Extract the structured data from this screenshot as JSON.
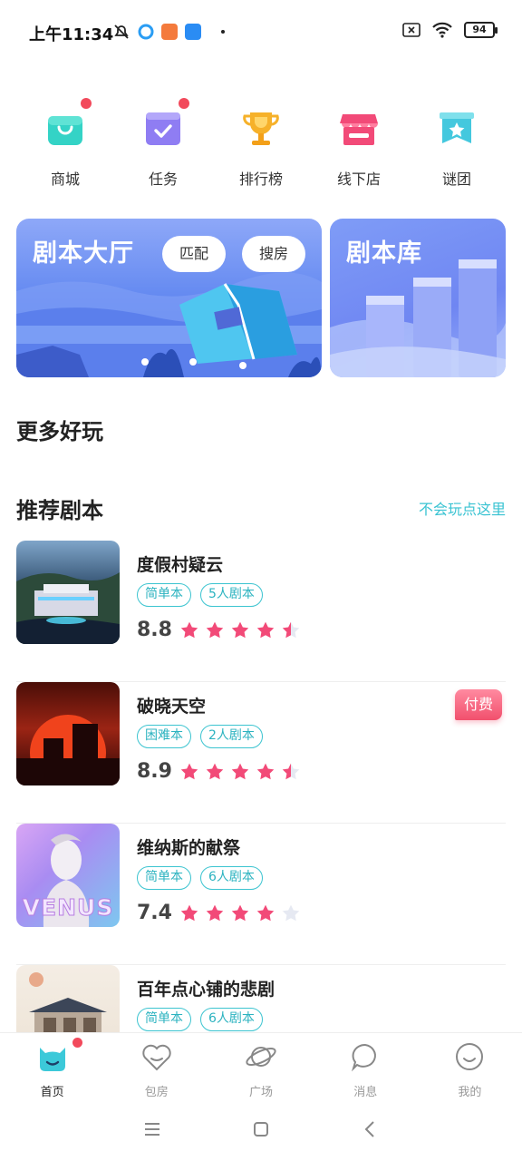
{
  "status_bar": {
    "time": "上午11:34",
    "battery": "94",
    "icons": [
      "bell-off-icon",
      "app-icon-blue",
      "app-icon-orange",
      "app-icon-upload",
      "dot-icon",
      "sim-off-icon",
      "wifi-icon",
      "battery-icon"
    ]
  },
  "quick_menu": [
    {
      "label": "商城",
      "icon": "shop-bag-icon",
      "color": "#34d3c6",
      "dot": true
    },
    {
      "label": "任务",
      "icon": "task-check-icon",
      "color": "#8f7df3",
      "dot": true
    },
    {
      "label": "排行榜",
      "icon": "trophy-icon",
      "color": "#f6b12a",
      "dot": false
    },
    {
      "label": "线下店",
      "icon": "store-icon",
      "color": "#f24a78",
      "dot": false
    },
    {
      "label": "谜团",
      "icon": "mystery-star-icon",
      "color": "#44c8de",
      "dot": false
    }
  ],
  "banners": {
    "hall": {
      "title": "剧本大厅",
      "match_label": "匹配",
      "search_label": "搜房"
    },
    "library": {
      "title": "剧本库"
    }
  },
  "sections": {
    "more_fun": "更多好玩",
    "recommended": "推荐剧本",
    "help_link": "不会玩点这里"
  },
  "scripts": [
    {
      "title": "度假村疑云",
      "tags": [
        "简单本",
        "5人剧本"
      ],
      "score": "8.8",
      "stars": 4.5,
      "paid": false
    },
    {
      "title": "破晓天空",
      "tags": [
        "困难本",
        "2人剧本"
      ],
      "score": "8.9",
      "stars": 4.5,
      "paid": true,
      "paid_label": "付费"
    },
    {
      "title": "维纳斯的献祭",
      "tags": [
        "简单本",
        "6人剧本"
      ],
      "score": "7.4",
      "stars": 4,
      "paid": false,
      "thumb_text": "VENUS"
    },
    {
      "title": "百年点心铺的悲剧",
      "tags": [
        "简单本",
        "6人剧本"
      ],
      "score": "",
      "stars": 0,
      "paid": false
    }
  ],
  "tabbar": [
    {
      "label": "首页",
      "icon": "home-cat-icon",
      "active": true,
      "dot": true
    },
    {
      "label": "包房",
      "icon": "heart-room-icon",
      "active": false,
      "dot": false
    },
    {
      "label": "广场",
      "icon": "planet-icon",
      "active": false,
      "dot": false
    },
    {
      "label": "消息",
      "icon": "chat-bubble-icon",
      "active": false,
      "dot": false
    },
    {
      "label": "我的",
      "icon": "smile-face-icon",
      "active": false,
      "dot": false
    }
  ],
  "colors": {
    "accent": "#3cc4d0",
    "star": "#f24a78",
    "paid": "#f1506d",
    "banner_blue": "#5f86f0"
  }
}
